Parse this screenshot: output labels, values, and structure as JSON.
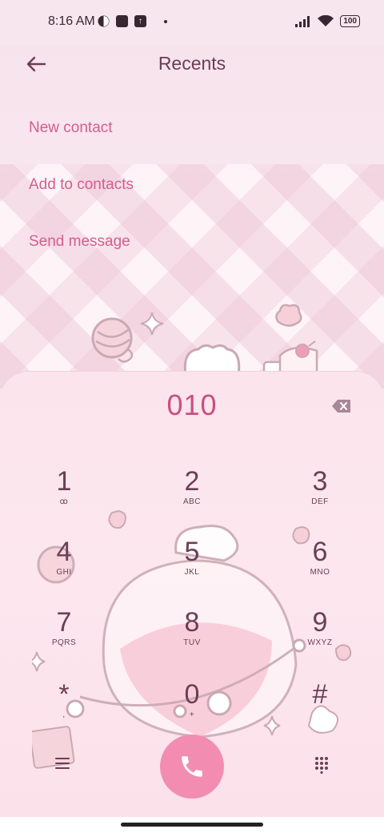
{
  "status_bar": {
    "time": "8:16 AM",
    "battery": "100",
    "upload_glyph": "↑"
  },
  "header": {
    "title": "Recents"
  },
  "menu": [
    {
      "label": "New contact"
    },
    {
      "label": "Add to contacts"
    },
    {
      "label": "Send message"
    }
  ],
  "dialer": {
    "number": "010",
    "keys": [
      {
        "digit": "1",
        "letters": "ꝏ"
      },
      {
        "digit": "2",
        "letters": "ABC"
      },
      {
        "digit": "3",
        "letters": "DEF"
      },
      {
        "digit": "4",
        "letters": "GHI"
      },
      {
        "digit": "5",
        "letters": "JKL"
      },
      {
        "digit": "6",
        "letters": "MNO"
      },
      {
        "digit": "7",
        "letters": "PQRS"
      },
      {
        "digit": "8",
        "letters": "TUV"
      },
      {
        "digit": "9",
        "letters": "WXYZ"
      },
      {
        "digit": "*",
        "letters": ","
      },
      {
        "digit": "0",
        "letters": "+"
      },
      {
        "digit": "#",
        "letters": ""
      }
    ]
  },
  "colors": {
    "accent": "#d25f8c",
    "call": "#f28db1",
    "text": "#6b3e55"
  },
  "icons": [
    "back-arrow-icon",
    "backspace-icon",
    "phone-icon",
    "menu-icon",
    "dialpad-icon",
    "voicemail-icon"
  ]
}
